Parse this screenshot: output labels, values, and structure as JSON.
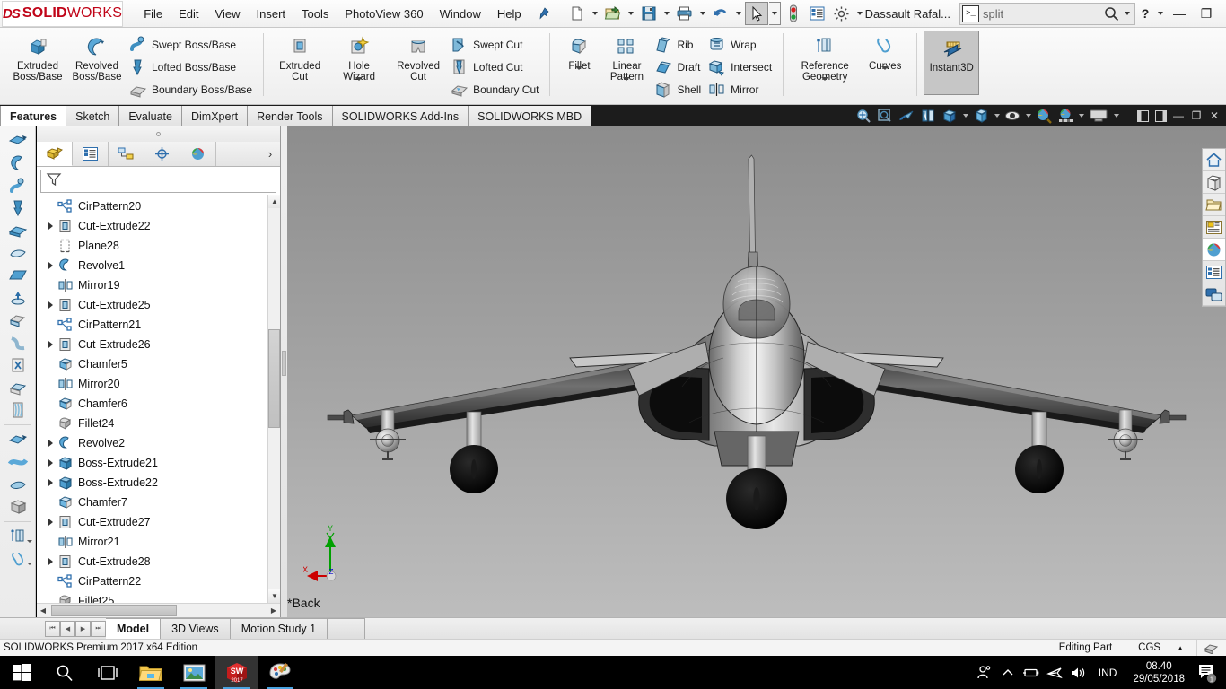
{
  "titlebar": {
    "logo_ds": "DS",
    "logo_bold": "SOLID",
    "logo_thin": "WORKS",
    "menus": [
      "File",
      "Edit",
      "View",
      "Insert",
      "Tools",
      "PhotoView 360",
      "Window",
      "Help"
    ],
    "pin_icon": "pushpin-icon",
    "quick_access": [
      {
        "name": "new-document",
        "icon": "new-file-icon",
        "caret": true
      },
      {
        "name": "open-document",
        "icon": "open-folder-icon",
        "caret": true
      },
      {
        "name": "save-document",
        "icon": "save-disk-icon",
        "caret": true
      },
      {
        "name": "print-document",
        "icon": "printer-icon",
        "caret": true
      },
      {
        "name": "undo",
        "icon": "undo-arrow-icon",
        "caret": true
      },
      {
        "name": "select",
        "icon": "cursor-arrow-icon",
        "caret": true,
        "selected": true
      },
      {
        "name": "rebuild",
        "icon": "traffic-light-icon",
        "caret": false
      },
      {
        "name": "file-properties",
        "icon": "properties-list-icon",
        "caret": false
      },
      {
        "name": "options",
        "icon": "gear-icon",
        "caret": true
      }
    ],
    "document_title": "Dassault Rafal...",
    "search_value": "split",
    "search_cmd_glyph": ">_",
    "search_icon": "magnifier-icon",
    "help_label": "?",
    "minimize_label": "—",
    "restore_label": "❐",
    "close_label": "✕"
  },
  "ribbon": {
    "groups": [
      {
        "name": "boss-base-group",
        "big": [
          {
            "label": "Extruded\nBoss/Base",
            "icon": "extruded-boss-icon",
            "caret": false
          },
          {
            "label": "Revolved\nBoss/Base",
            "icon": "revolved-boss-icon",
            "caret": false
          }
        ],
        "small": [
          {
            "label": "Swept Boss/Base",
            "icon": "swept-boss-icon"
          },
          {
            "label": "Lofted Boss/Base",
            "icon": "lofted-boss-icon"
          },
          {
            "label": "Boundary Boss/Base",
            "icon": "boundary-boss-icon"
          }
        ]
      },
      {
        "name": "cut-group",
        "big": [
          {
            "label": "Extruded\nCut",
            "icon": "extruded-cut-icon",
            "caret": false
          },
          {
            "label": "Hole\nWizard",
            "icon": "hole-wizard-icon",
            "caret": true
          },
          {
            "label": "Revolved\nCut",
            "icon": "revolved-cut-icon",
            "caret": false
          }
        ],
        "small": [
          {
            "label": "Swept Cut",
            "icon": "swept-cut-icon"
          },
          {
            "label": "Lofted Cut",
            "icon": "lofted-cut-icon"
          },
          {
            "label": "Boundary Cut",
            "icon": "boundary-cut-icon"
          }
        ]
      },
      {
        "name": "feature-group",
        "big": [
          {
            "label": "Fillet",
            "icon": "fillet-icon",
            "caret": true
          },
          {
            "label": "Linear\nPattern",
            "icon": "linear-pattern-icon",
            "caret": true
          }
        ],
        "small": [
          {
            "label": "Rib",
            "icon": "rib-icon"
          },
          {
            "label": "Draft",
            "icon": "draft-icon"
          },
          {
            "label": "Shell",
            "icon": "shell-icon"
          }
        ],
        "small2": [
          {
            "label": "Wrap",
            "icon": "wrap-icon"
          },
          {
            "label": "Intersect",
            "icon": "intersect-icon"
          },
          {
            "label": "Mirror",
            "icon": "mirror-icon"
          }
        ]
      },
      {
        "name": "reference-group",
        "big": [
          {
            "label": "Reference\nGeometry",
            "icon": "reference-geometry-icon",
            "caret": true
          },
          {
            "label": "Curves",
            "icon": "curves-icon",
            "caret": true
          }
        ]
      },
      {
        "name": "instant3d-group",
        "big": [
          {
            "label": "Instant3D",
            "icon": "instant3d-icon",
            "caret": false,
            "active": true
          }
        ]
      }
    ]
  },
  "command_tabs": {
    "tabs": [
      "Features",
      "Sketch",
      "Evaluate",
      "DimXpert",
      "Render Tools",
      "SOLIDWORKS Add-Ins",
      "SOLIDWORKS MBD"
    ],
    "active": "Features",
    "view_tools": [
      {
        "name": "zoom-to-fit-icon",
        "caret": false
      },
      {
        "name": "zoom-to-area-icon",
        "caret": false
      },
      {
        "name": "previous-view-icon",
        "caret": false
      },
      {
        "name": "section-view-icon",
        "caret": false
      },
      {
        "name": "view-orientation-icon",
        "caret": true
      },
      {
        "name": "display-style-icon",
        "caret": true
      },
      {
        "name": "hide-show-items-icon",
        "caret": true
      },
      {
        "name": "edit-appearance-icon",
        "caret": false
      },
      {
        "name": "apply-scene-icon",
        "caret": true
      },
      {
        "name": "view-settings-icon",
        "caret": true
      }
    ],
    "window_controls": [
      "❐",
      "❐",
      "—",
      "❐",
      "✕"
    ]
  },
  "left_strip": {
    "icons": [
      "extruded-boss-tool-icon",
      "revolved-boss-tool-icon",
      "swept-boss-tool-icon",
      "lofted-boss-tool-icon",
      "boundary-boss-tool-icon",
      "fill-surface-tool-icon",
      "planar-surface-tool-icon",
      "extrude-surface-tool-icon",
      "knit-surface-tool-icon",
      "radiate-surface-tool-icon",
      "delete-face-tool-icon",
      "replace-face-tool-icon",
      "thicken-tool-icon",
      "move-face-tool-icon",
      "flex-tool-icon",
      "freeform-tool-icon",
      "deform-tool-icon",
      "reference-geometry-tool-icon",
      "curves-tool-icon"
    ]
  },
  "tree": {
    "tabs": [
      {
        "name": "feature-manager-tab",
        "icon": "yellow-block-icon",
        "active": true
      },
      {
        "name": "property-manager-tab",
        "icon": "property-list-icon",
        "active": false
      },
      {
        "name": "configuration-manager-tab",
        "icon": "configuration-icon",
        "active": false
      },
      {
        "name": "dimxpert-manager-tab",
        "icon": "dimxpert-target-icon",
        "active": false
      },
      {
        "name": "display-manager-tab",
        "icon": "display-sphere-icon",
        "active": false
      }
    ],
    "more_label": "›",
    "filter_icon": "filter-funnel-icon",
    "items": [
      {
        "label": "CirPattern20",
        "icon": "circular-pattern-icon",
        "expandable": false,
        "indent": 0
      },
      {
        "label": "Cut-Extrude22",
        "icon": "cut-extrude-icon",
        "expandable": true,
        "indent": 0
      },
      {
        "label": "Plane28",
        "icon": "plane-icon",
        "expandable": false,
        "indent": 0
      },
      {
        "label": "Revolve1",
        "icon": "revolve-icon",
        "expandable": true,
        "indent": 0
      },
      {
        "label": "Mirror19",
        "icon": "mirror-feature-icon",
        "expandable": false,
        "indent": 0
      },
      {
        "label": "Cut-Extrude25",
        "icon": "cut-extrude-icon",
        "expandable": true,
        "indent": 0
      },
      {
        "label": "CirPattern21",
        "icon": "circular-pattern-icon",
        "expandable": false,
        "indent": 0
      },
      {
        "label": "Cut-Extrude26",
        "icon": "cut-extrude-icon",
        "expandable": true,
        "indent": 0
      },
      {
        "label": "Chamfer5",
        "icon": "chamfer-icon",
        "expandable": false,
        "indent": 0
      },
      {
        "label": "Mirror20",
        "icon": "mirror-feature-icon",
        "expandable": false,
        "indent": 0
      },
      {
        "label": "Chamfer6",
        "icon": "chamfer-icon",
        "expandable": false,
        "indent": 0
      },
      {
        "label": "Fillet24",
        "icon": "fillet-feature-icon",
        "expandable": false,
        "indent": 0
      },
      {
        "label": "Revolve2",
        "icon": "revolve-icon",
        "expandable": true,
        "indent": 0
      },
      {
        "label": "Boss-Extrude21",
        "icon": "boss-extrude-icon",
        "expandable": true,
        "indent": 0
      },
      {
        "label": "Boss-Extrude22",
        "icon": "boss-extrude-icon",
        "expandable": true,
        "indent": 0
      },
      {
        "label": "Chamfer7",
        "icon": "chamfer-icon",
        "expandable": false,
        "indent": 0
      },
      {
        "label": "Cut-Extrude27",
        "icon": "cut-extrude-icon",
        "expandable": true,
        "indent": 0
      },
      {
        "label": "Mirror21",
        "icon": "mirror-feature-icon",
        "expandable": false,
        "indent": 0
      },
      {
        "label": "Cut-Extrude28",
        "icon": "cut-extrude-icon",
        "expandable": true,
        "indent": 0
      },
      {
        "label": "CirPattern22",
        "icon": "circular-pattern-icon",
        "expandable": false,
        "indent": 0
      },
      {
        "label": "Fillet25",
        "icon": "fillet-feature-icon",
        "expandable": false,
        "indent": 0
      }
    ]
  },
  "viewport": {
    "view_label": "*Back",
    "background_top": "#8e8e8e",
    "background_bottom": "#b8b8b8",
    "triad": {
      "x_label": "X",
      "y_label": "Y",
      "z_label": "Z",
      "x_color": "#cc0000",
      "y_color": "#00a000",
      "z_color": "#0000cc"
    },
    "model_name": "Dassault Rafale fighter jet front view"
  },
  "right_toolbar": {
    "buttons": [
      {
        "name": "home-icon",
        "active": false
      },
      {
        "name": "solidworks-resources-icon",
        "active": false
      },
      {
        "name": "design-library-icon",
        "active": false
      },
      {
        "name": "file-explorer-icon",
        "active": false
      },
      {
        "name": "view-palette-icon",
        "active": true
      },
      {
        "name": "appearances-scenes-icon",
        "active": false
      },
      {
        "name": "custom-properties-icon",
        "active": false
      }
    ]
  },
  "bottom_tabs": {
    "nav": [
      "⏮",
      "◀",
      "▶",
      "⏭"
    ],
    "tabs": [
      "Model",
      "3D Views",
      "Motion Study 1"
    ],
    "active": "Model"
  },
  "statusbar": {
    "left_text": "SOLIDWORKS Premium 2017 x64 Edition",
    "editing_state": "Editing Part",
    "units": "CGS",
    "units_caret": "▲",
    "overlay_icon": "sketch-overlay-icon"
  },
  "taskbar": {
    "buttons": [
      {
        "name": "start-button",
        "icon": "windows-logo-icon",
        "running": false,
        "active": false
      },
      {
        "name": "search-taskbar-button",
        "icon": "search-magnifier-icon",
        "running": false,
        "active": false
      },
      {
        "name": "task-view-button",
        "icon": "task-view-icon",
        "running": false,
        "active": false
      },
      {
        "name": "file-explorer-taskbar-button",
        "icon": "folder-icon",
        "running": true,
        "active": false
      },
      {
        "name": "photos-taskbar-button",
        "icon": "photo-icon",
        "running": true,
        "active": false
      },
      {
        "name": "solidworks-taskbar-button",
        "icon": "solidworks-cube-icon",
        "running": true,
        "active": true,
        "badge": "2017"
      },
      {
        "name": "paint-taskbar-button",
        "icon": "paint-palette-icon",
        "running": true,
        "active": false
      }
    ],
    "tray": [
      {
        "name": "people-icon",
        "glyph": "⛹"
      },
      {
        "name": "show-hidden-icons-chevron",
        "glyph": "∧"
      },
      {
        "name": "battery-icon",
        "glyph": "▭"
      },
      {
        "name": "network-icon",
        "glyph": "✈"
      },
      {
        "name": "volume-icon",
        "glyph": "🔊"
      }
    ],
    "language": "IND",
    "time": "08.40",
    "date": "29/05/2018",
    "notification_count": "1",
    "notification_icon": "action-center-icon"
  }
}
